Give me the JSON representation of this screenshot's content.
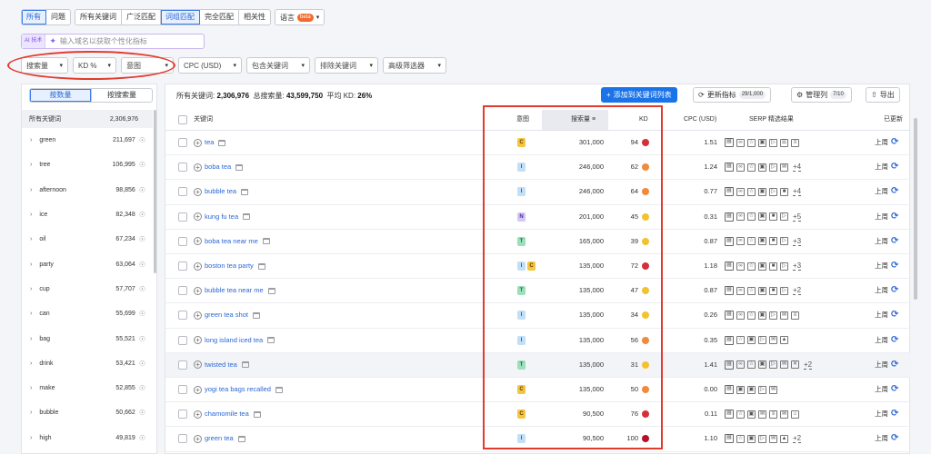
{
  "filters_row1": {
    "group1": [
      "所有",
      "问题"
    ],
    "group2": [
      "所有关键词",
      "广泛匹配",
      "词组匹配",
      "完全匹配",
      "相关性"
    ],
    "language_label": "语言",
    "beta_badge": "beta"
  },
  "ai": {
    "tag": "AI 技术",
    "placeholder": "输入域名以获取个性化指标"
  },
  "filters_row3": [
    "搜索量",
    "KD %",
    "意图",
    "CPC (USD)",
    "包含关键词",
    "排除关键词",
    "高级筛选器"
  ],
  "left_panel": {
    "toggle": [
      "按数量",
      "按搜索量"
    ],
    "header_label": "所有关键词",
    "header_value": "2,306,976",
    "groups": [
      {
        "name": "green",
        "value": "211,697"
      },
      {
        "name": "tree",
        "value": "106,995"
      },
      {
        "name": "afternoon",
        "value": "98,856"
      },
      {
        "name": "ice",
        "value": "82,348"
      },
      {
        "name": "oil",
        "value": "67,234"
      },
      {
        "name": "party",
        "value": "63,064"
      },
      {
        "name": "cup",
        "value": "57,707"
      },
      {
        "name": "can",
        "value": "55,699"
      },
      {
        "name": "bag",
        "value": "55,521"
      },
      {
        "name": "drink",
        "value": "53,421"
      },
      {
        "name": "make",
        "value": "52,855"
      },
      {
        "name": "bubble",
        "value": "50,662"
      },
      {
        "name": "high",
        "value": "49,819"
      }
    ]
  },
  "stats": {
    "all_keywords_label": "所有关键词:",
    "all_keywords_value": "2,306,976",
    "total_volume_label": "总搜索量:",
    "total_volume_value": "43,599,750",
    "avg_kd_label": "平均 KD:",
    "avg_kd_value": "26%"
  },
  "toolbar": {
    "add_list": "添加到关键词列表",
    "update_metrics": "更新指标",
    "update_count": "29/1,000",
    "manage_columns": "管理列",
    "manage_count": "7/10",
    "export": "导出"
  },
  "columns": {
    "keyword": "关键词",
    "intent": "意图",
    "volume": "搜索量",
    "kd": "KD",
    "cpc": "CPC (USD)",
    "serp": "SERP 精选结果",
    "updated": "已更新"
  },
  "colors": {
    "kd_red": "#d62f3a",
    "kd_orange": "#f08a3c",
    "kd_yellow": "#f2c230",
    "link_blue": "#2a67d6",
    "highlight_red": "#e23a2e"
  },
  "rows": [
    {
      "keyword": "tea",
      "intent": [
        "C"
      ],
      "volume": "301,000",
      "kd": "94",
      "kd_color": "#d62f3a",
      "cpc": "1.51",
      "serp": [
        "img",
        "link",
        "star",
        "pic",
        "play",
        "doc",
        "list"
      ],
      "more": "",
      "updated": "上周"
    },
    {
      "keyword": "boba tea",
      "intent": [
        "I"
      ],
      "volume": "246,000",
      "kd": "62",
      "kd_color": "#f08a3c",
      "cpc": "1.24",
      "serp": [
        "img",
        "link",
        "star",
        "pic",
        "play",
        "chat"
      ],
      "more": "+4",
      "updated": "上周"
    },
    {
      "keyword": "bubble tea",
      "intent": [
        "I"
      ],
      "volume": "246,000",
      "kd": "64",
      "kd_color": "#f08a3c",
      "cpc": "0.77",
      "serp": [
        "img",
        "link",
        "star",
        "pic",
        "play",
        "vid"
      ],
      "more": "+4",
      "updated": "上周"
    },
    {
      "keyword": "kung fu tea",
      "intent": [
        "N"
      ],
      "volume": "201,000",
      "kd": "45",
      "kd_color": "#f2c230",
      "cpc": "0.31",
      "serp": [
        "img",
        "link",
        "star",
        "pic",
        "vid",
        "play"
      ],
      "more": "+5",
      "updated": "上周"
    },
    {
      "keyword": "boba tea near me",
      "intent": [
        "T"
      ],
      "volume": "165,000",
      "kd": "39",
      "kd_color": "#f2c230",
      "cpc": "0.87",
      "serp": [
        "img",
        "link",
        "star",
        "pic",
        "vid",
        "play"
      ],
      "more": "+3",
      "updated": "上周"
    },
    {
      "keyword": "boston tea party",
      "intent": [
        "I",
        "C"
      ],
      "volume": "135,000",
      "kd": "72",
      "kd_color": "#d62f3a",
      "cpc": "1.18",
      "serp": [
        "img",
        "link",
        "star",
        "pic",
        "vid",
        "play"
      ],
      "more": "+3",
      "updated": "上周"
    },
    {
      "keyword": "bubble tea near me",
      "intent": [
        "T"
      ],
      "volume": "135,000",
      "kd": "47",
      "kd_color": "#f2c230",
      "cpc": "0.87",
      "serp": [
        "img",
        "link",
        "star",
        "pic",
        "vid",
        "play"
      ],
      "more": "+2",
      "updated": "上周"
    },
    {
      "keyword": "green tea shot",
      "intent": [
        "I"
      ],
      "volume": "135,000",
      "kd": "34",
      "kd_color": "#f2c230",
      "cpc": "0.26",
      "serp": [
        "img",
        "link",
        "star",
        "pic",
        "play",
        "chat",
        "list"
      ],
      "more": "",
      "updated": "上周"
    },
    {
      "keyword": "long island iced tea",
      "intent": [
        "I"
      ],
      "volume": "135,000",
      "kd": "56",
      "kd_color": "#f08a3c",
      "cpc": "0.35",
      "serp": [
        "img",
        "star",
        "pic",
        "play",
        "chat",
        "cap"
      ],
      "more": "",
      "updated": "上周"
    },
    {
      "keyword": "twisted tea",
      "intent": [
        "T"
      ],
      "volume": "135,000",
      "kd": "31",
      "kd_color": "#f2c230",
      "cpc": "1.41",
      "serp": [
        "img",
        "link",
        "star",
        "pic",
        "play",
        "chat",
        "x"
      ],
      "more": "+2",
      "updated": "上周"
    },
    {
      "keyword": "yogi tea bags recalled",
      "intent": [
        "C"
      ],
      "volume": "135,000",
      "kd": "50",
      "kd_color": "#f08a3c",
      "cpc": "0.00",
      "serp": [
        "img",
        "pic",
        "pic",
        "play",
        "chat"
      ],
      "more": "",
      "updated": "上周"
    },
    {
      "keyword": "chamomile tea",
      "intent": [
        "C"
      ],
      "volume": "90,500",
      "kd": "76",
      "kd_color": "#d62f3a",
      "cpc": "0.11",
      "serp": [
        "img",
        "star",
        "pic",
        "chat",
        "list",
        "chat",
        "cart"
      ],
      "more": "",
      "updated": "上周"
    },
    {
      "keyword": "green tea",
      "intent": [
        "I"
      ],
      "volume": "90,500",
      "kd": "100",
      "kd_color": "#b3122a",
      "cpc": "1.10",
      "serp": [
        "img",
        "star",
        "pic",
        "play",
        "chat",
        "cap"
      ],
      "more": "+2",
      "updated": "上周"
    }
  ]
}
